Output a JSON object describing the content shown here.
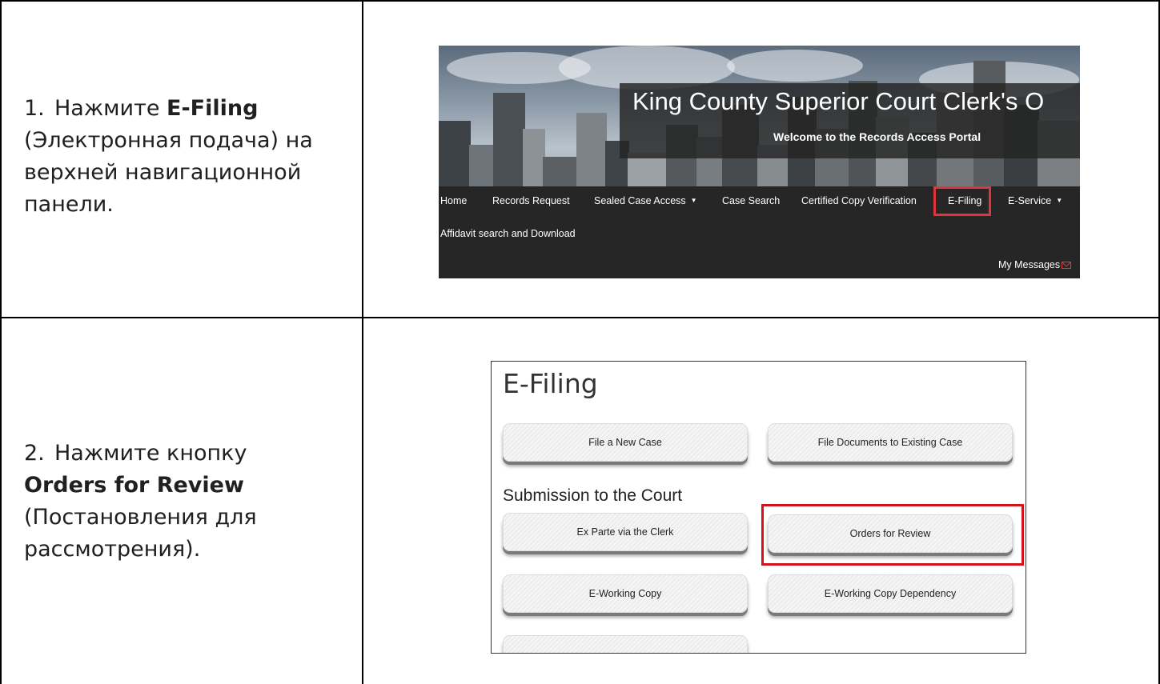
{
  "steps": [
    {
      "number": "1.",
      "lines": [
        "Нажмите ",
        "E-Filing",
        "(Электронная подача) на",
        "верхней навигационной",
        "панели."
      ]
    },
    {
      "number": "2.",
      "lines": [
        "Нажмите кнопку",
        "Orders for Review",
        "(Постановления для",
        "рассмотрения)."
      ]
    }
  ],
  "header_shot": {
    "site_title": "King County Superior Court Clerk's O",
    "site_subtitle": "Welcome to the Records Access Portal",
    "nav": [
      {
        "label": "Home",
        "has_caret": false
      },
      {
        "label": "Records Request",
        "has_caret": false
      },
      {
        "label": "Sealed Case Access",
        "has_caret": true
      },
      {
        "label": "Case Search",
        "has_caret": false
      },
      {
        "label": "Certified Copy Verification",
        "has_caret": false
      },
      {
        "label": "E-Filing",
        "has_caret": false,
        "highlighted": true
      },
      {
        "label": "E-Service",
        "has_caret": true
      }
    ],
    "nav_row2": "Affidavit search and Download",
    "messages_label": "My Messages",
    "colors": {
      "navbar": "#262626",
      "highlight": "#e0343a",
      "mail_icon": "#e03a3a"
    }
  },
  "efiling_shot": {
    "title": "E-Filing",
    "section_heading": "Submission to the Court",
    "buttons": {
      "file_new_case": "File a New Case",
      "file_existing": "File Documents to Existing Case",
      "ex_parte": "Ex Parte via the Clerk",
      "orders_review": "Orders for Review",
      "working_copy": "E-Working Copy",
      "working_copy_dep": "E-Working Copy Dependency"
    },
    "colors": {
      "highlight": "#d1141c"
    }
  }
}
